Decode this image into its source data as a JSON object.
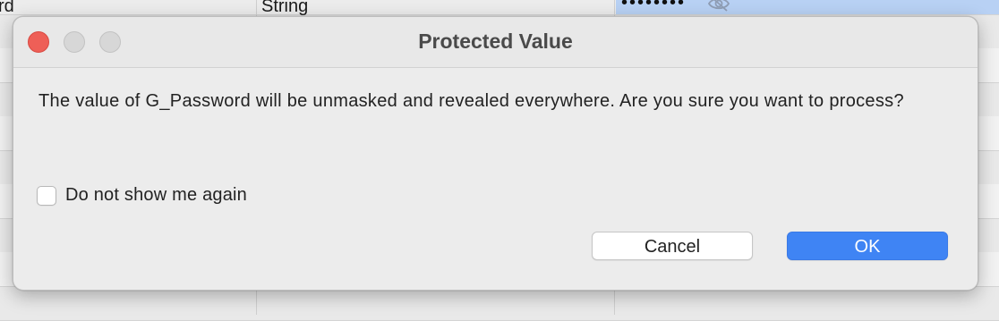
{
  "background_table": {
    "cells": [
      "rd",
      "String"
    ],
    "masked_value": "••••••••",
    "eye_icon": "eye-slash-icon"
  },
  "dialog": {
    "title": "Protected Value",
    "message": "The value of G_Password will be unmasked and revealed everywhere. Are you sure you want to process?",
    "checkbox_label": "Do not show me again",
    "checkbox_checked": false,
    "cancel_label": "Cancel",
    "ok_label": "OK"
  },
  "colors": {
    "close_button": "#ee5f57",
    "primary_button": "#3f84f4",
    "selection": "#b8d1f4"
  }
}
